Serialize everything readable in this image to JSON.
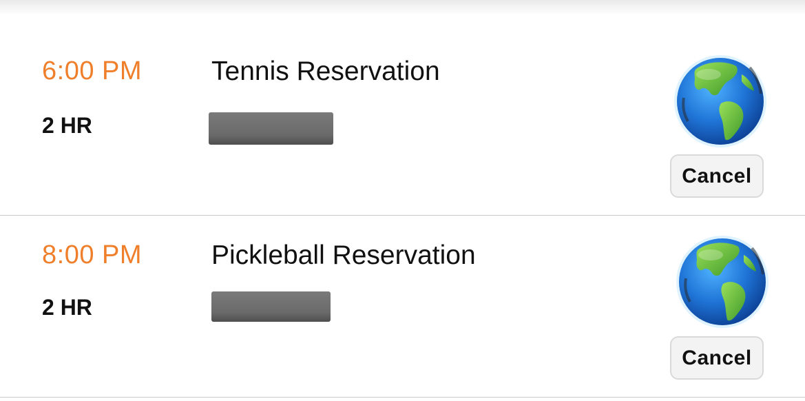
{
  "reservations": [
    {
      "time": "6:00 PM",
      "duration": "2 HR",
      "title": "Tennis Reservation",
      "cancel_label": "Cancel"
    },
    {
      "time": "8:00 PM",
      "duration": "2 HR",
      "title": "Pickleball Reservation",
      "cancel_label": "Cancel"
    }
  ],
  "colors": {
    "time_accent": "#ef7f2a",
    "text": "#111111",
    "divider": "#c8c8c8",
    "button_bg": "#f3f3f3",
    "redaction": "#6a6a6a"
  },
  "icons": {
    "location": "globe-icon"
  }
}
